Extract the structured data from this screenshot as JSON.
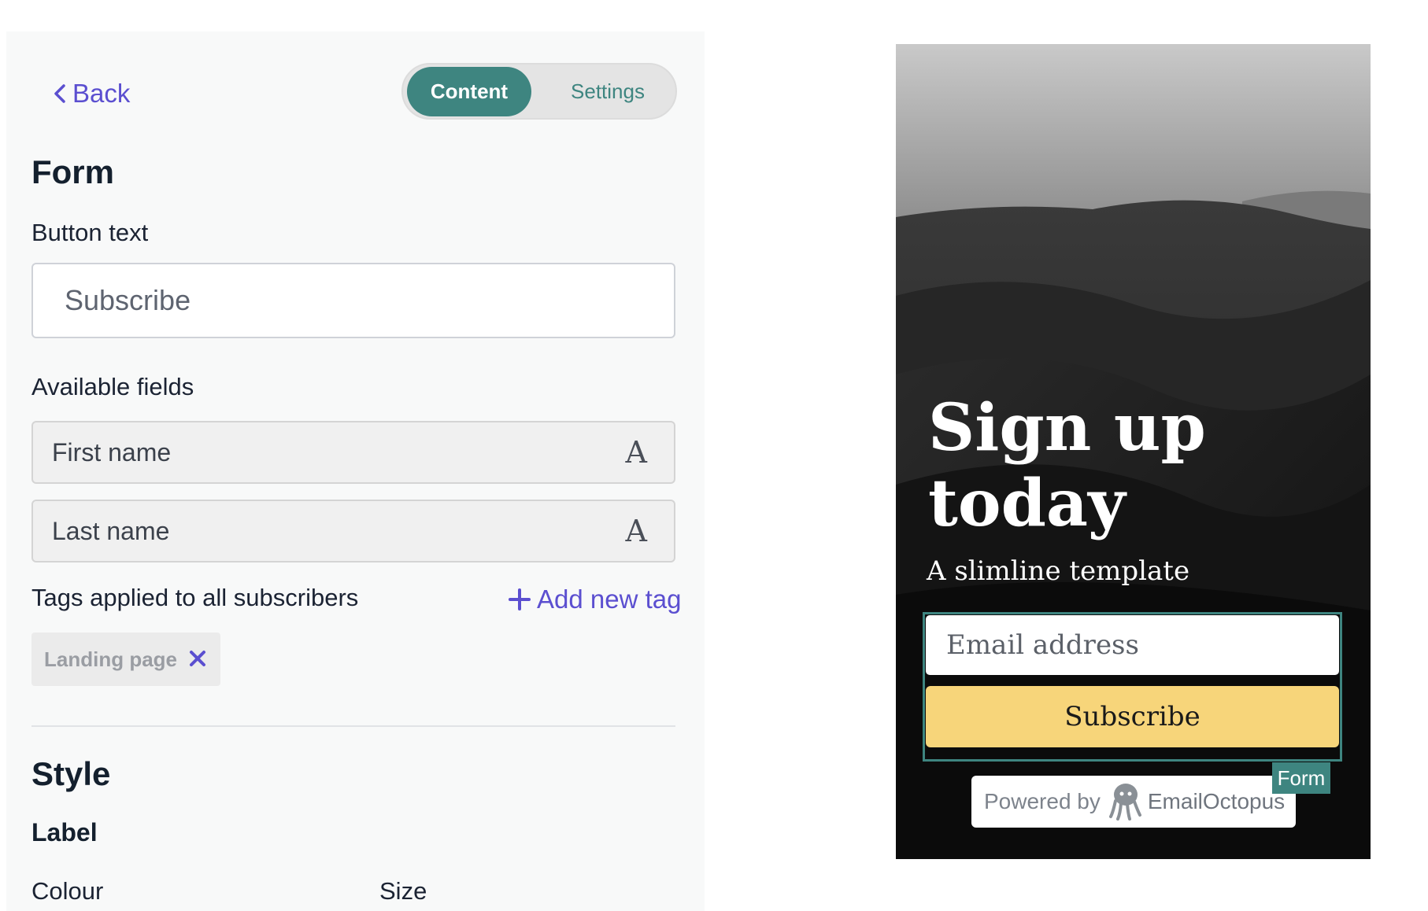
{
  "editor": {
    "back_label": "Back",
    "tabs": [
      {
        "label": "Content",
        "active": true
      },
      {
        "label": "Settings",
        "active": false
      }
    ],
    "form_heading": "Form",
    "button_text_label": "Button text",
    "button_text_value": "Subscribe",
    "available_fields_label": "Available fields",
    "fields": [
      {
        "label": "First name",
        "icon": "text-type-icon",
        "icon_glyph": "A"
      },
      {
        "label": "Last name",
        "icon": "text-type-icon",
        "icon_glyph": "A"
      }
    ],
    "tags_label": "Tags applied to all subscribers",
    "add_tag_label": "Add new tag",
    "tags": [
      {
        "label": "Landing page"
      }
    ],
    "style_heading": "Style",
    "label_heading": "Label",
    "colour_label": "Colour",
    "size_label": "Size"
  },
  "preview": {
    "title_line1": "Sign up",
    "title_line2": "today",
    "subtitle": "A slimline template",
    "email_placeholder": "Email address",
    "button_label": "Subscribe",
    "form_badge": "Form",
    "powered_by": "Powered by",
    "brand": "EmailOctopus"
  },
  "colors": {
    "accent_teal": "#3e8580",
    "link_purple": "#5b4fd0",
    "button_yellow": "#f7d57a"
  }
}
